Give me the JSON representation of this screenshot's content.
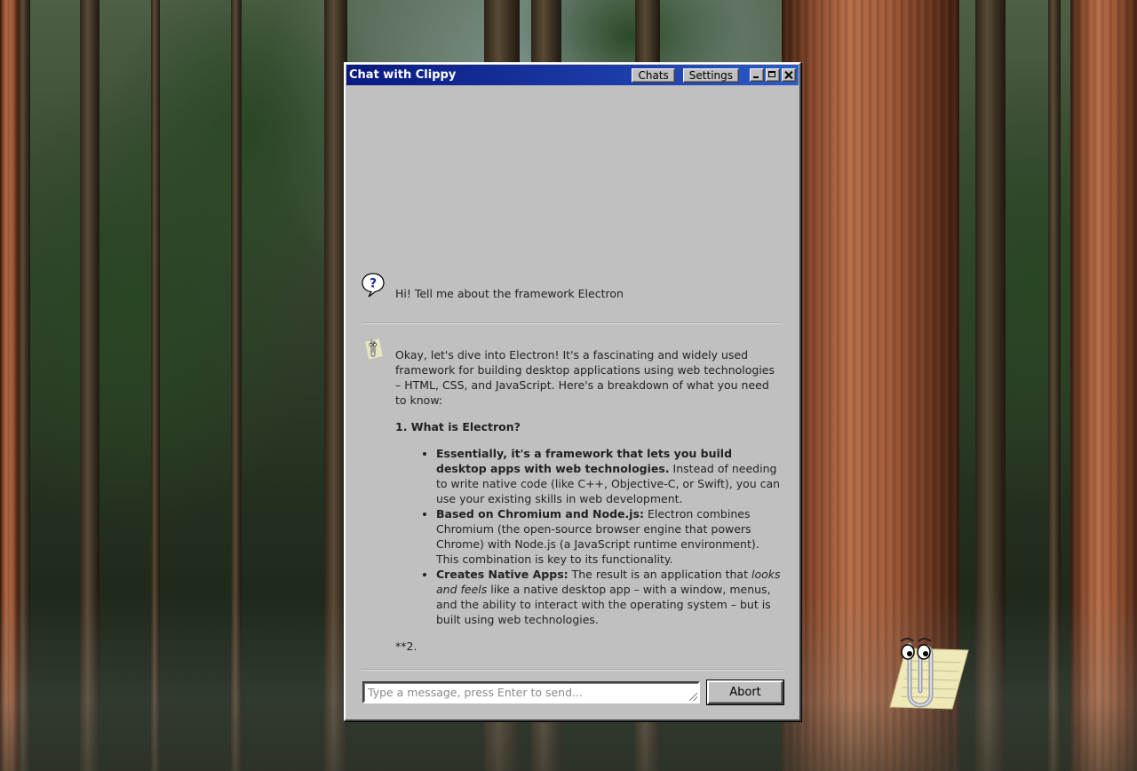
{
  "window": {
    "title": "Chat with Clippy",
    "chats_label": "Chats",
    "settings_label": "Settings"
  },
  "messages": {
    "user": {
      "text": "Hi! Tell me about the framework Electron"
    },
    "assistant": {
      "intro": "Okay, let's dive into Electron! It's a fascinating and widely used framework for building desktop applications using web technologies – HTML, CSS, and JavaScript. Here's a breakdown of what you need to know:",
      "heading": "1. What is Electron?",
      "bullets": [
        {
          "bold": "Essentially, it's a framework that lets you build desktop apps with web technologies.",
          "text": " Instead of needing to write native code (like C++, Objective-C, or Swift), you can use your existing skills in web development."
        },
        {
          "bold": "Based on Chromium and Node.js:",
          "text": " Electron combines Chromium (the open-source browser engine that powers Chrome) with Node.js (a JavaScript runtime environment). This combination is key to its functionality."
        },
        {
          "bold": "Creates Native Apps:",
          "text_before": " The result is an application that ",
          "italic": "looks and feels",
          "text_after": " like a native desktop app – with a window, menus, and the ability to interact with the operating system – but is built using web technologies."
        }
      ],
      "trailing": "**2."
    }
  },
  "input": {
    "placeholder": "Type a message, press Enter to send...",
    "value": ""
  },
  "abort_label": "Abort",
  "icons": {
    "user_avatar": "question-bubble-icon",
    "assistant_avatar": "clippy-icon",
    "minimize": "minimize-icon",
    "maximize": "maximize-icon",
    "close": "close-icon"
  },
  "colors": {
    "titlebar_start": "#0a1a80",
    "titlebar_end": "#2e5cc8",
    "window_face": "#c0c0c0"
  }
}
